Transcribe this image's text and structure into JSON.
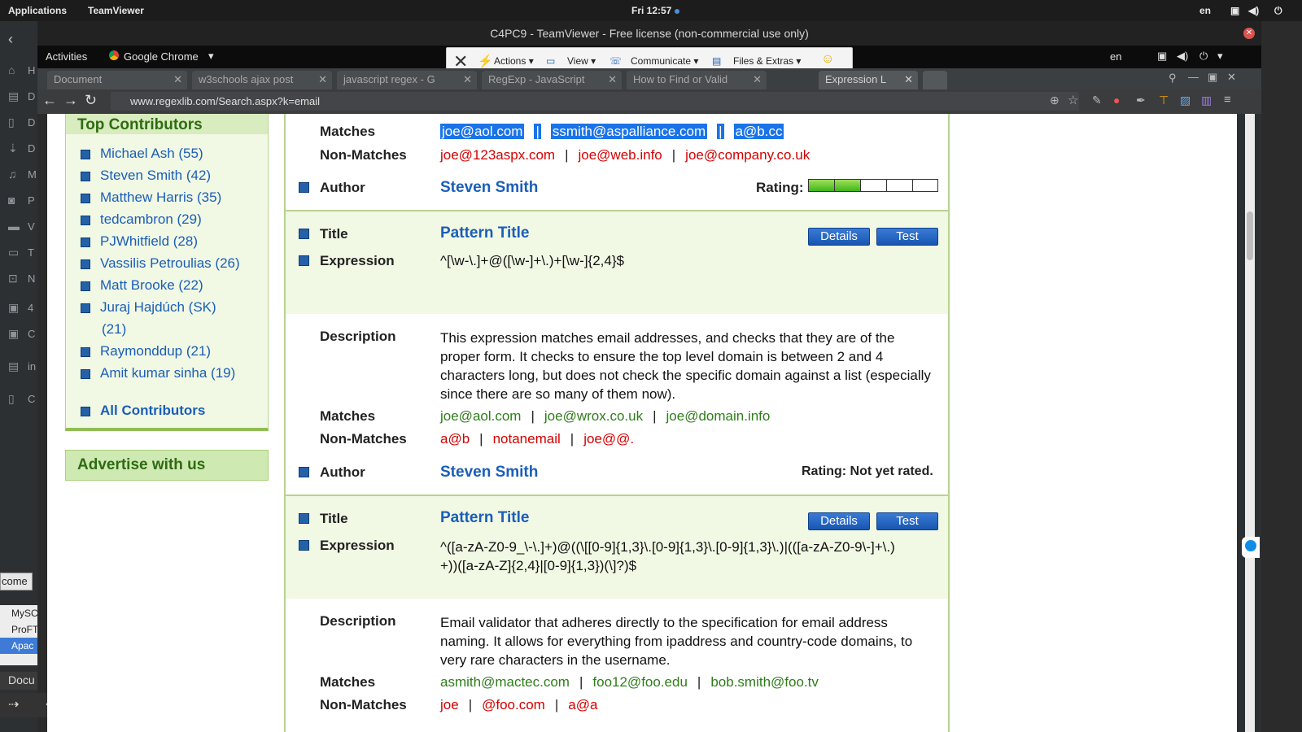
{
  "gnome": {
    "applications": "Applications",
    "app": "TeamViewer",
    "clock": "Fri 12:57",
    "lang": "en"
  },
  "host_sidebar": [
    "H",
    "D",
    "D",
    "D",
    "M",
    "P",
    "V",
    "T",
    "N",
    "4",
    "C",
    "in",
    "C"
  ],
  "host_task": {
    "label1": "come",
    "items": [
      "MySC",
      "ProFT",
      "Apac"
    ],
    "docu": "Docu"
  },
  "teamviewer": {
    "title": "C4PC9 - TeamViewer - Free license (non-commercial use only)",
    "toolbar": {
      "actions": "Actions",
      "view": "View",
      "communicate": "Communicate",
      "files": "Files & Extras"
    }
  },
  "remote_bar": {
    "activities": "Activities",
    "app": "Google Chrome",
    "lang": "en"
  },
  "tabs": [
    "Document",
    "w3schools ajax post",
    "javascript regex - G",
    "RegExp - JavaScript",
    "How to Find or Valid",
    "Expression L"
  ],
  "address": "www.regexlib.com/Search.aspx?k=email",
  "sidebar": {
    "heading": "Top Contributors",
    "contributors": [
      "Michael Ash (55)",
      "Steven Smith (42)",
      "Matthew Harris (35)",
      "tedcambron (29)",
      "PJWhitfield (28)",
      "Vassilis Petroulias (26)",
      "Matt Brooke (22)",
      "Juraj Hajdúch (SK)",
      "(21)",
      "Raymonddup (21)",
      "Amit kumar sinha (19)"
    ],
    "all": "All Contributors",
    "advertise": "Advertise with us"
  },
  "labels": {
    "title": "Title",
    "expression": "Expression",
    "description": "Description",
    "matches": "Matches",
    "non_matches": "Non-Matches",
    "author": "Author",
    "rating": "Rating:",
    "details": "Details",
    "test": "Test",
    "rating_not": "Rating: Not yet rated."
  },
  "entry0": {
    "matches": [
      "joe@aol.com",
      "ssmith@aspalliance.com",
      "a@b.cc"
    ],
    "non_matches": [
      "joe@123aspx.com",
      "joe@web.info",
      "joe@company.co.uk"
    ],
    "author": "Steven Smith",
    "rating_fraction": 0.4
  },
  "entry1": {
    "title": "Pattern Title",
    "expression": "^[\\w-\\.]+@([\\w-]+\\.)+[\\w-]{2,4}$",
    "description": "This expression matches email addresses, and checks that they are of the proper form. It checks to ensure the top level domain is between 2 and 4 characters long, but does not check the specific domain against a list (especially since there are so many of them now).",
    "matches": [
      "joe@aol.com",
      "joe@wrox.co.uk",
      "joe@domain.info"
    ],
    "non_matches": [
      "a@b",
      "notanemail",
      "joe@@."
    ],
    "author": "Steven Smith"
  },
  "entry2": {
    "title": "Pattern Title",
    "expression": "^([a-zA-Z0-9_\\-\\.]+)@((\\[[0-9]{1,3}\\.[0-9]{1,3}\\.[0-9]{1,3}\\.)|(([a-zA-Z0-9\\-]+\\.)+))([a-zA-Z]{2,4}|[0-9]{1,3})(\\]?)$",
    "description": "Email validator that adheres directly to the specification for email address naming. It allows for everything from ipaddress and country-code domains, to very rare characters in the username.",
    "matches": [
      "asmith@mactec.com",
      "foo12@foo.edu",
      "bob.smith@foo.tv"
    ],
    "non_matches": [
      "joe",
      "@foo.com",
      "a@a"
    ]
  }
}
